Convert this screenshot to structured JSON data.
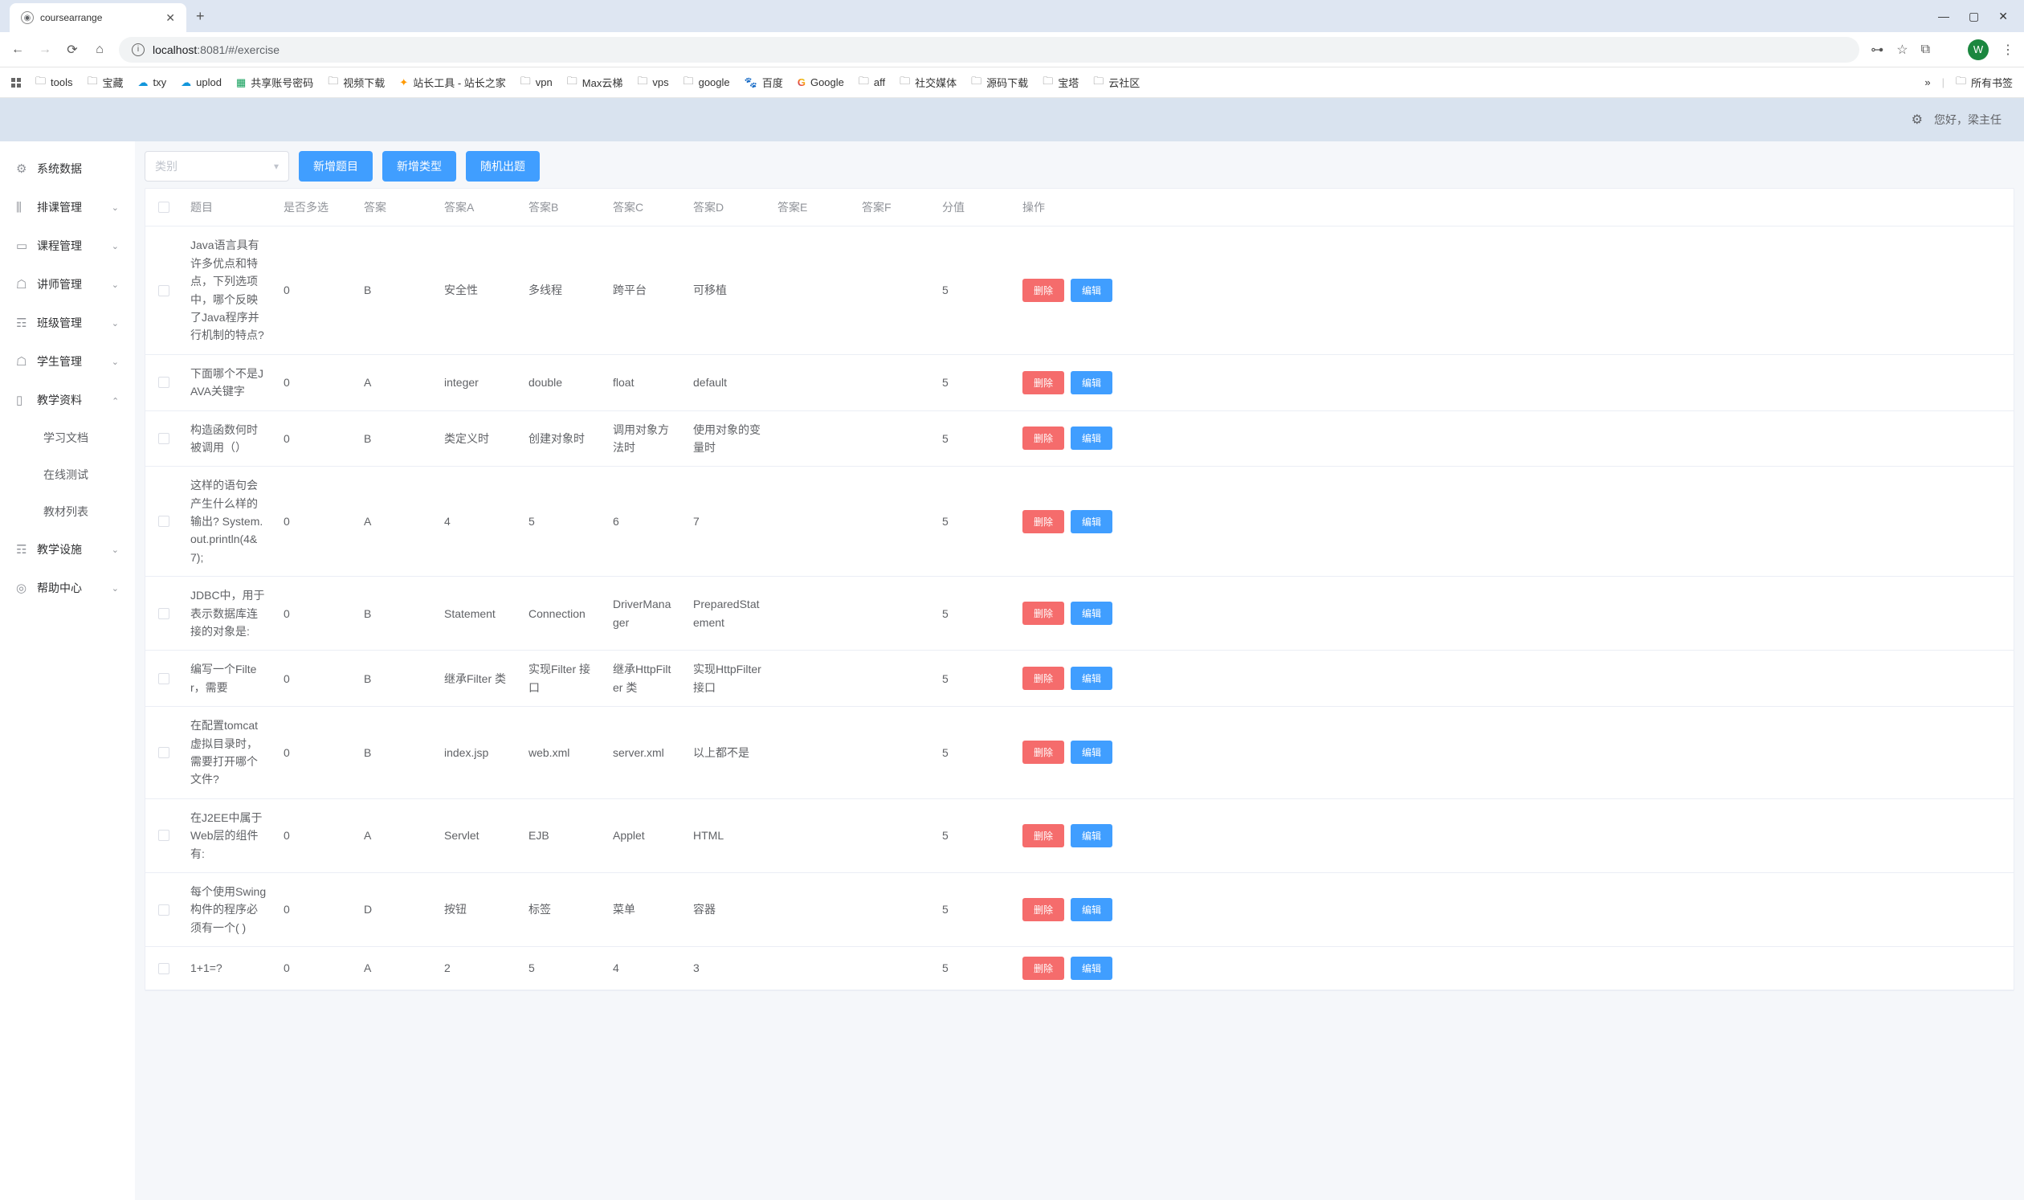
{
  "browser": {
    "tab_title": "coursearrange",
    "url_host": "localhost",
    "url_port": ":8081",
    "url_path": "/#/exercise",
    "avatar_letter": "W",
    "bookmarks": [
      {
        "label": "tools",
        "icon": "folder"
      },
      {
        "label": "宝藏",
        "icon": "folder"
      },
      {
        "label": "txy",
        "icon": "cloud-blue"
      },
      {
        "label": "uplod",
        "icon": "cloud-blue"
      },
      {
        "label": "共享账号密码",
        "icon": "sheet"
      },
      {
        "label": "视频下载",
        "icon": "folder"
      },
      {
        "label": "站长工具 - 站长之家",
        "icon": "tool"
      },
      {
        "label": "vpn",
        "icon": "folder"
      },
      {
        "label": "Max云梯",
        "icon": "folder"
      },
      {
        "label": "vps",
        "icon": "folder"
      },
      {
        "label": "google",
        "icon": "folder"
      },
      {
        "label": "百度",
        "icon": "baidu"
      },
      {
        "label": "Google",
        "icon": "google"
      },
      {
        "label": "aff",
        "icon": "folder"
      },
      {
        "label": "社交媒体",
        "icon": "folder"
      },
      {
        "label": "源码下载",
        "icon": "folder"
      },
      {
        "label": "宝塔",
        "icon": "folder"
      },
      {
        "label": "云社区",
        "icon": "folder"
      }
    ],
    "all_bookmarks_label": "所有书签"
  },
  "header": {
    "greeting": "您好，梁主任"
  },
  "sidebar": {
    "items": [
      {
        "label": "系统数据",
        "icon": "⚙",
        "expandable": false
      },
      {
        "label": "排课管理",
        "icon": "⫼",
        "expandable": true
      },
      {
        "label": "课程管理",
        "icon": "▭",
        "expandable": true
      },
      {
        "label": "讲师管理",
        "icon": "☖",
        "expandable": true
      },
      {
        "label": "班级管理",
        "icon": "☶",
        "expandable": true
      },
      {
        "label": "学生管理",
        "icon": "☖",
        "expandable": true
      },
      {
        "label": "教学资料",
        "icon": "▯",
        "expandable": true,
        "open": true,
        "children": [
          {
            "label": "学习文档"
          },
          {
            "label": "在线测试"
          },
          {
            "label": "教材列表"
          }
        ]
      },
      {
        "label": "教学设施",
        "icon": "☶",
        "expandable": true
      },
      {
        "label": "帮助中心",
        "icon": "◎",
        "expandable": true
      }
    ]
  },
  "action_bar": {
    "select_placeholder": "类别",
    "btn_add_question": "新增题目",
    "btn_add_type": "新增类型",
    "btn_random": "随机出题"
  },
  "table": {
    "headers": {
      "title": "题目",
      "multi": "是否多选",
      "answer": "答案",
      "a": "答案A",
      "b": "答案B",
      "c": "答案C",
      "d": "答案D",
      "e": "答案E",
      "f": "答案F",
      "score": "分值",
      "op": "操作"
    },
    "op_delete": "删除",
    "op_edit": "编辑",
    "rows": [
      {
        "title": "Java语言具有许多优点和特点，下列选项中，哪个反映了Java程序并行机制的特点?",
        "multi": "0",
        "answer": "B",
        "a": "安全性",
        "b": "多线程",
        "c": "跨平台",
        "d": "可移植",
        "e": "",
        "f": "",
        "score": "5"
      },
      {
        "title": "下面哪个不是JAVA关键字",
        "multi": "0",
        "answer": "A",
        "a": "integer",
        "b": "double",
        "c": "float",
        "d": "default",
        "e": "",
        "f": "",
        "score": "5"
      },
      {
        "title": "构造函数何时被调用（）",
        "multi": "0",
        "answer": "B",
        "a": "类定义时",
        "b": "创建对象时",
        "c": "调用对象方法时",
        "d": "使用对象的变量时",
        "e": "",
        "f": "",
        "score": "5"
      },
      {
        "title": "这样的语句会产生什么样的输出? System.out.println(4&amp;7);",
        "multi": "0",
        "answer": "A",
        "a": "4",
        "b": "5",
        "c": "6",
        "d": "7",
        "e": "",
        "f": "",
        "score": "5"
      },
      {
        "title": "JDBC中，用于表示数据库连接的对象是:",
        "multi": "0",
        "answer": "B",
        "a": "Statement",
        "b": "Connection",
        "c": "DriverManager",
        "d": "PreparedStatement",
        "e": "",
        "f": "",
        "score": "5"
      },
      {
        "title": "编写一个Filter，需要",
        "multi": "0",
        "answer": "B",
        "a": "继承Filter 类",
        "b": "实现Filter 接口",
        "c": "继承HttpFilter 类",
        "d": "实现HttpFilter接口",
        "e": "",
        "f": "",
        "score": "5"
      },
      {
        "title": "在配置tomcat虚拟目录时，需要打开哪个文件?",
        "multi": "0",
        "answer": "B",
        "a": "index.jsp",
        "b": "web.xml",
        "c": "server.xml",
        "d": "以上都不是",
        "e": "",
        "f": "",
        "score": "5"
      },
      {
        "title": "在J2EE中属于Web层的组件有:",
        "multi": "0",
        "answer": "A",
        "a": "Servlet",
        "b": "EJB",
        "c": "Applet",
        "d": "HTML",
        "e": "",
        "f": "",
        "score": "5"
      },
      {
        "title": "每个使用Swing构件的程序必须有一个( )",
        "multi": "0",
        "answer": "D",
        "a": "按钮",
        "b": "标签",
        "c": "菜单",
        "d": "容器",
        "e": "",
        "f": "",
        "score": "5"
      },
      {
        "title": "1+1=?",
        "multi": "0",
        "answer": "A",
        "a": "2",
        "b": "5",
        "c": "4",
        "d": "3",
        "e": "",
        "f": "",
        "score": "5"
      }
    ]
  }
}
